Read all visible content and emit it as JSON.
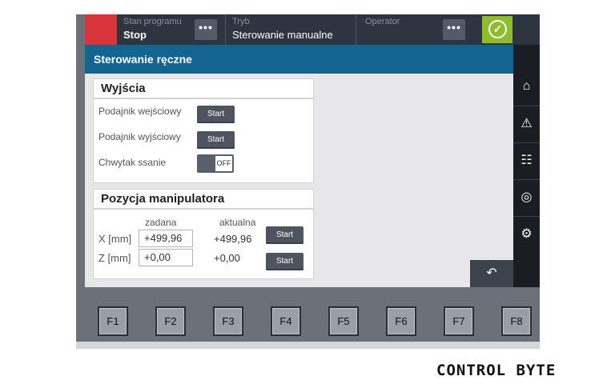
{
  "header": {
    "program_state_label": "Stan programu",
    "program_state_value": "Stop",
    "mode_label": "Tryb",
    "mode_value": "Sterowanie manualne",
    "operator_label": "Operator",
    "operator_value": "",
    "dots": "•••",
    "ok_icon": "✓"
  },
  "title": "Sterowanie ręczne",
  "outputs": {
    "title": "Wyjścia",
    "rows": [
      {
        "label": "Podajnik wejściowy",
        "button": "Start"
      },
      {
        "label": "Podajnik wyjściowy",
        "button": "Start"
      },
      {
        "label": "Chwytak ssanie",
        "toggle": "OFF"
      }
    ]
  },
  "position": {
    "title": "Pozycja manipulatora",
    "col_set": "zadana",
    "col_actual": "aktualna",
    "rows": [
      {
        "label": "X [mm]",
        "set": "+499,96",
        "actual": "+499,96",
        "button": "Start"
      },
      {
        "label": "Z [mm]",
        "set": "+0,00",
        "actual": "+0,00",
        "button": "Start"
      }
    ]
  },
  "nav": {
    "icons": [
      "home-icon",
      "warning-icon",
      "document-search-icon",
      "dashboard-icon",
      "gear-icon"
    ],
    "glyphs": [
      "⌂",
      "⚠",
      "☷",
      "◎",
      "⚙"
    ]
  },
  "back_glyph": "↶",
  "fkeys": [
    "F1",
    "F2",
    "F3",
    "F4",
    "F5",
    "F6",
    "F7",
    "F8"
  ],
  "logo": "CONTROL BYTE",
  "colors": {
    "status_red": "#d9343a",
    "title_blue": "#146492",
    "ok_green": "#8dbd2d"
  }
}
